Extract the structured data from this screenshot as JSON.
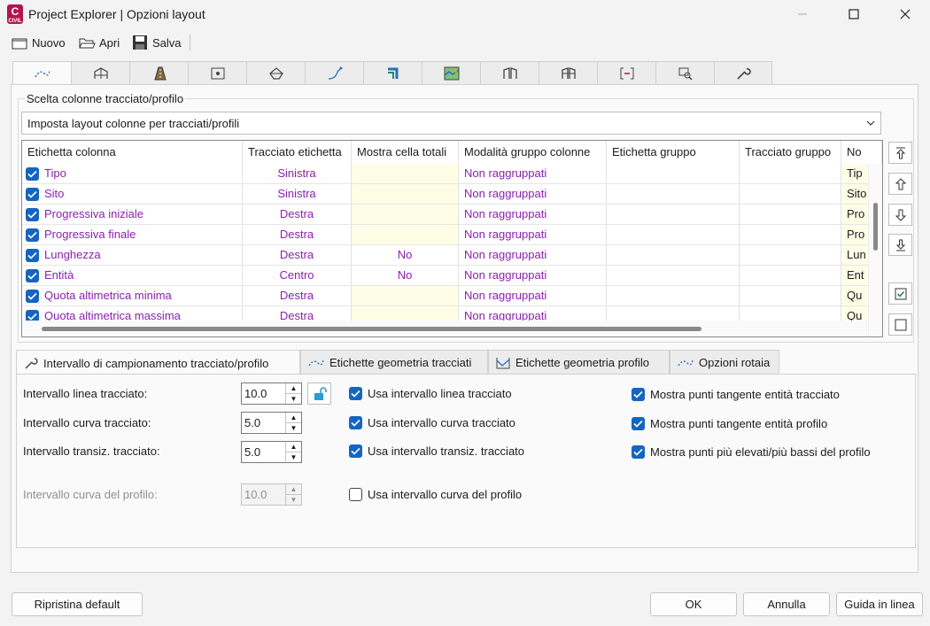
{
  "window": {
    "title": "Project Explorer | Opzioni layout",
    "app_icon_letter": "C",
    "app_icon_sub": "CIVIL"
  },
  "toolbar": {
    "new_label": "Nuovo",
    "open_label": "Apri",
    "save_label": "Salva"
  },
  "top_tabs": [
    "alignment-tab-icon",
    "bridge-tab-icon",
    "road-tab-icon",
    "section-tab-icon",
    "surface-tab-icon",
    "profile-tab-icon",
    "pipe-tab-icon",
    "map-tab-icon",
    "corridor-tab-icon",
    "assembly-tab-icon",
    "view-tab-icon",
    "search-tab-icon",
    "wrench-tab-icon"
  ],
  "column_group": {
    "title": "Scelta colonne tracciato/profilo",
    "combo_value": "Imposta layout colonne per tracciati/profili"
  },
  "grid": {
    "headers": [
      "Etichetta colonna",
      "Tracciato etichetta",
      "Mostra cella totali",
      "Modalità gruppo colonne",
      "Etichetta gruppo",
      "Tracciato gruppo",
      "No"
    ],
    "rows": [
      {
        "label": "Tipo",
        "align": "Sinistra",
        "totals": "",
        "group_mode": "Non raggruppati",
        "group_label": "",
        "group_align": "",
        "extra": "Tip"
      },
      {
        "label": "Sito",
        "align": "Sinistra",
        "totals": "",
        "group_mode": "Non raggruppati",
        "group_label": "",
        "group_align": "",
        "extra": "Sito"
      },
      {
        "label": "Progressiva iniziale",
        "align": "Destra",
        "totals": "",
        "group_mode": "Non raggruppati",
        "group_label": "",
        "group_align": "",
        "extra": "Pro"
      },
      {
        "label": "Progressiva finale",
        "align": "Destra",
        "totals": "",
        "group_mode": "Non raggruppati",
        "group_label": "",
        "group_align": "",
        "extra": "Pro"
      },
      {
        "label": "Lunghezza",
        "align": "Destra",
        "totals": "No",
        "group_mode": "Non raggruppati",
        "group_label": "",
        "group_align": "",
        "extra": "Lun"
      },
      {
        "label": "Entità",
        "align": "Centro",
        "totals": "No",
        "group_mode": "Non raggruppati",
        "group_label": "",
        "group_align": "",
        "extra": "Ent"
      },
      {
        "label": "Quota altimetrica minima",
        "align": "Destra",
        "totals": "",
        "group_mode": "Non raggruppati",
        "group_label": "",
        "group_align": "",
        "extra": "Qu"
      },
      {
        "label": "Quota altimetrica massima",
        "align": "Destra",
        "totals": "",
        "group_mode": "Non raggruppati",
        "group_label": "",
        "group_align": "",
        "extra": "Qu"
      }
    ]
  },
  "bottom_tabs": {
    "sampling": "Intervallo di campionamento tracciato/profilo",
    "alignment_labels": "Etichette geometria tracciati",
    "profile_labels": "Etichette geometria profilo",
    "rail_options": "Opzioni rotaia"
  },
  "sampling": {
    "line_label": "Intervallo linea tracciato:",
    "line_value": "10.0",
    "curve_label": "Intervallo curva tracciato:",
    "curve_value": "5.0",
    "spiral_label": "Intervallo transiz. tracciato:",
    "spiral_value": "5.0",
    "profile_curve_label": "Intervallo curva del profilo:",
    "profile_curve_value": "10.0",
    "use_line": "Usa intervallo linea tracciato",
    "use_curve": "Usa intervallo curva tracciato",
    "use_spiral": "Usa intervallo transiz. tracciato",
    "use_profile_curve": "Usa intervallo curva del profilo",
    "show_alignment_tangent": "Mostra punti tangente entità tracciato",
    "show_profile_tangent": "Mostra punti tangente entità profilo",
    "show_high_low": "Mostra punti più elevati/più bassi del profilo"
  },
  "footer": {
    "reset": "Ripristina default",
    "ok": "OK",
    "cancel": "Annulla",
    "help": "Guida in linea"
  }
}
